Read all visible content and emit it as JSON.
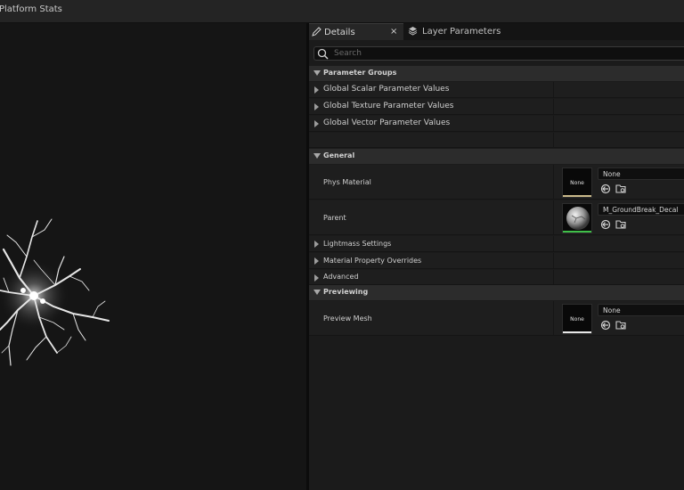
{
  "toolbar": {
    "title": "Platform Stats"
  },
  "tabs": {
    "details": "Details",
    "details_close": "×",
    "layer_parameters": "Layer Parameters"
  },
  "search": {
    "placeholder": "Search",
    "value": ""
  },
  "sections": {
    "parameter_groups": "Parameter Groups",
    "general": "General",
    "previewing": "Previewing"
  },
  "parameter_groups": [
    {
      "label": "Global Scalar Parameter Values"
    },
    {
      "label": "Global Texture Parameter Values"
    },
    {
      "label": "Global Vector Parameter Values"
    }
  ],
  "general": {
    "phys_material": {
      "label": "Phys Material",
      "thumb": "None",
      "value": "None",
      "accent": "#c9b98a"
    },
    "parent": {
      "label": "Parent",
      "value": "M_GroundBreak_Decal",
      "accent": "#3fbf48"
    },
    "lightmass": "Lightmass Settings",
    "overrides": "Material Property Overrides",
    "advanced": "Advanced"
  },
  "previewing": {
    "preview_mesh": {
      "label": "Preview Mesh",
      "thumb": "None",
      "value": "None",
      "accent": "#e8e8e8"
    }
  },
  "icons": {
    "details_tab": "pencil-icon",
    "layer_tab": "layers-icon",
    "search": "search-icon",
    "use_selected": "use-selected-asset-icon",
    "browse": "browse-folder-icon"
  }
}
